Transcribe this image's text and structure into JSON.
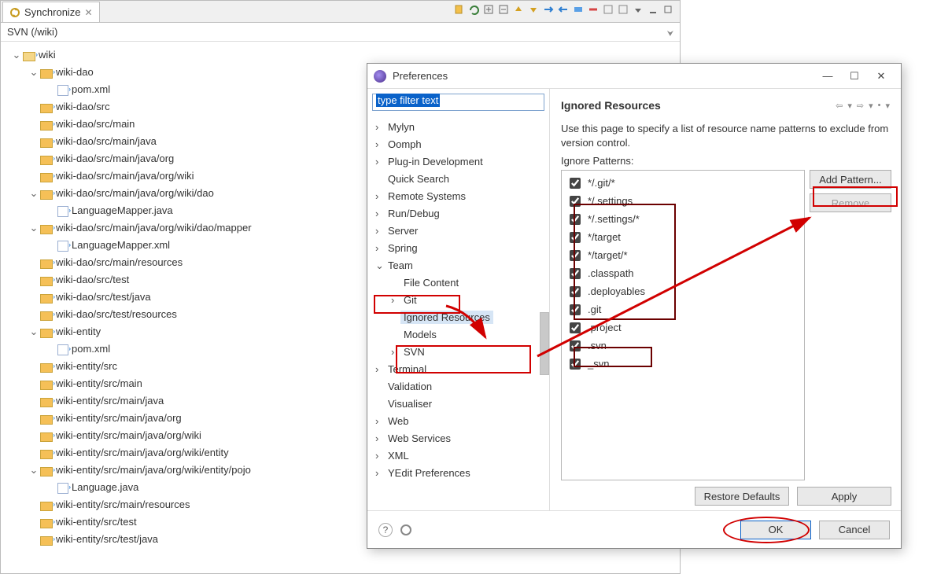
{
  "sync": {
    "tab_label": "Synchronize",
    "svn_path": "SVN (/wiki)",
    "tree": [
      {
        "indent": 0,
        "type": "folder-open",
        "twisty": "v",
        "label": "wiki"
      },
      {
        "indent": 1,
        "type": "folder",
        "twisty": "v",
        "label": "wiki-dao"
      },
      {
        "indent": 2,
        "type": "file",
        "label": "pom.xml"
      },
      {
        "indent": 1,
        "type": "folder",
        "label": "wiki-dao/src"
      },
      {
        "indent": 1,
        "type": "folder",
        "label": "wiki-dao/src/main"
      },
      {
        "indent": 1,
        "type": "folder",
        "label": "wiki-dao/src/main/java"
      },
      {
        "indent": 1,
        "type": "folder",
        "label": "wiki-dao/src/main/java/org"
      },
      {
        "indent": 1,
        "type": "folder",
        "label": "wiki-dao/src/main/java/org/wiki"
      },
      {
        "indent": 1,
        "type": "folder",
        "twisty": "v",
        "label": "wiki-dao/src/main/java/org/wiki/dao"
      },
      {
        "indent": 2,
        "type": "file",
        "label": "LanguageMapper.java"
      },
      {
        "indent": 1,
        "type": "folder",
        "twisty": "v",
        "label": "wiki-dao/src/main/java/org/wiki/dao/mapper"
      },
      {
        "indent": 2,
        "type": "file",
        "label": "LanguageMapper.xml"
      },
      {
        "indent": 1,
        "type": "folder",
        "label": "wiki-dao/src/main/resources"
      },
      {
        "indent": 1,
        "type": "folder",
        "label": "wiki-dao/src/test"
      },
      {
        "indent": 1,
        "type": "folder",
        "label": "wiki-dao/src/test/java"
      },
      {
        "indent": 1,
        "type": "folder",
        "label": "wiki-dao/src/test/resources"
      },
      {
        "indent": 1,
        "type": "folder",
        "twisty": "v",
        "label": "wiki-entity"
      },
      {
        "indent": 2,
        "type": "file",
        "label": "pom.xml"
      },
      {
        "indent": 1,
        "type": "folder",
        "label": "wiki-entity/src"
      },
      {
        "indent": 1,
        "type": "folder",
        "label": "wiki-entity/src/main"
      },
      {
        "indent": 1,
        "type": "folder",
        "label": "wiki-entity/src/main/java"
      },
      {
        "indent": 1,
        "type": "folder",
        "label": "wiki-entity/src/main/java/org"
      },
      {
        "indent": 1,
        "type": "folder",
        "label": "wiki-entity/src/main/java/org/wiki"
      },
      {
        "indent": 1,
        "type": "folder",
        "label": "wiki-entity/src/main/java/org/wiki/entity"
      },
      {
        "indent": 1,
        "type": "folder",
        "twisty": "v",
        "label": "wiki-entity/src/main/java/org/wiki/entity/pojo"
      },
      {
        "indent": 2,
        "type": "file",
        "label": "Language.java"
      },
      {
        "indent": 1,
        "type": "folder",
        "label": "wiki-entity/src/main/resources"
      },
      {
        "indent": 1,
        "type": "folder",
        "label": "wiki-entity/src/test"
      },
      {
        "indent": 1,
        "type": "folder",
        "label": "wiki-entity/src/test/java"
      }
    ]
  },
  "dialog": {
    "title": "Preferences",
    "filter_text": "type filter text",
    "nav": [
      {
        "indent": 0,
        "twisty": ">",
        "label": "Mylyn"
      },
      {
        "indent": 0,
        "twisty": ">",
        "label": "Oomph"
      },
      {
        "indent": 0,
        "twisty": ">",
        "label": "Plug-in Development"
      },
      {
        "indent": 0,
        "twisty": "",
        "label": "Quick Search"
      },
      {
        "indent": 0,
        "twisty": ">",
        "label": "Remote Systems"
      },
      {
        "indent": 0,
        "twisty": ">",
        "label": "Run/Debug"
      },
      {
        "indent": 0,
        "twisty": ">",
        "label": "Server"
      },
      {
        "indent": 0,
        "twisty": ">",
        "label": "Spring"
      },
      {
        "indent": 0,
        "twisty": "v",
        "label": "Team"
      },
      {
        "indent": 1,
        "twisty": "",
        "label": "File Content"
      },
      {
        "indent": 1,
        "twisty": ">",
        "label": "Git"
      },
      {
        "indent": 1,
        "twisty": "",
        "label": "Ignored Resources",
        "selected": true
      },
      {
        "indent": 1,
        "twisty": "",
        "label": "Models"
      },
      {
        "indent": 1,
        "twisty": ">",
        "label": "SVN"
      },
      {
        "indent": 0,
        "twisty": ">",
        "label": "Terminal"
      },
      {
        "indent": 0,
        "twisty": "",
        "label": "Validation"
      },
      {
        "indent": 0,
        "twisty": "",
        "label": "Visualiser"
      },
      {
        "indent": 0,
        "twisty": ">",
        "label": "Web"
      },
      {
        "indent": 0,
        "twisty": ">",
        "label": "Web Services"
      },
      {
        "indent": 0,
        "twisty": ">",
        "label": "XML"
      },
      {
        "indent": 0,
        "twisty": ">",
        "label": "YEdit Preferences"
      }
    ],
    "page": {
      "title": "Ignored Resources",
      "desc": "Use this page to specify a list of resource name patterns to exclude from version control.",
      "list_label": "Ignore Patterns:",
      "patterns": [
        {
          "checked": true,
          "label": "*/.git/*"
        },
        {
          "checked": true,
          "label": "*/.settings"
        },
        {
          "checked": true,
          "label": "*/.settings/*"
        },
        {
          "checked": true,
          "label": "*/target"
        },
        {
          "checked": true,
          "label": "*/target/*"
        },
        {
          "checked": true,
          "label": ".classpath"
        },
        {
          "checked": true,
          "label": ".deployables"
        },
        {
          "checked": true,
          "label": ".git"
        },
        {
          "checked": true,
          "label": ".project"
        },
        {
          "checked": true,
          "label": ".svn"
        },
        {
          "checked": true,
          "label": "_svn"
        }
      ],
      "add_btn": "Add Pattern...",
      "remove_btn": "Remove",
      "restore_btn": "Restore Defaults",
      "apply_btn": "Apply"
    },
    "footer": {
      "ok": "OK",
      "cancel": "Cancel"
    }
  }
}
